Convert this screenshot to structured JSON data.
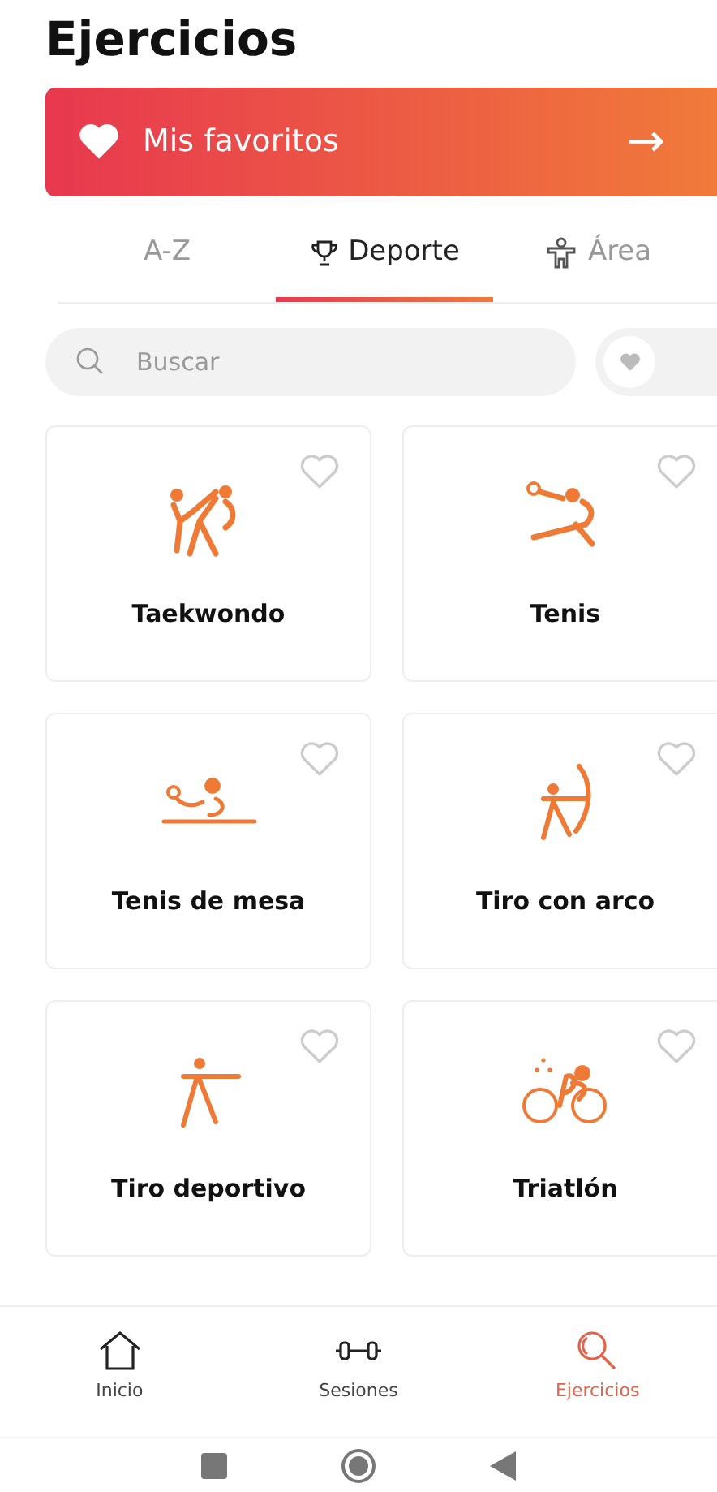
{
  "title": "Ejercicios",
  "favorites_banner": {
    "label": "Mis favoritos",
    "arrow": "→"
  },
  "tabs": [
    {
      "label": "A-Z",
      "kind": "text",
      "selected": false
    },
    {
      "label": "Deporte",
      "kind": "trophy",
      "selected": true
    },
    {
      "label": "Área",
      "kind": "body",
      "selected": false
    }
  ],
  "search": {
    "placeholder": "Buscar"
  },
  "favorites_filter": {
    "on": false
  },
  "sports": [
    {
      "name": "Taekwondo",
      "kind": "taekwondo",
      "favorite": false
    },
    {
      "name": "Tenis",
      "kind": "tennis",
      "favorite": false
    },
    {
      "name": "Tenis de mesa",
      "kind": "table_tennis",
      "favorite": false
    },
    {
      "name": "Tiro con arco",
      "kind": "archery",
      "favorite": false
    },
    {
      "name": "Tiro deportivo",
      "kind": "shooting",
      "favorite": false
    },
    {
      "name": "Triatlón",
      "kind": "triathlon",
      "favorite": false
    }
  ],
  "bottom_nav": [
    {
      "label": "Inicio",
      "kind": "home",
      "selected": false
    },
    {
      "label": "Sesiones",
      "kind": "dumbbell",
      "selected": false
    },
    {
      "label": "Ejercicios",
      "kind": "search",
      "selected": true
    }
  ]
}
